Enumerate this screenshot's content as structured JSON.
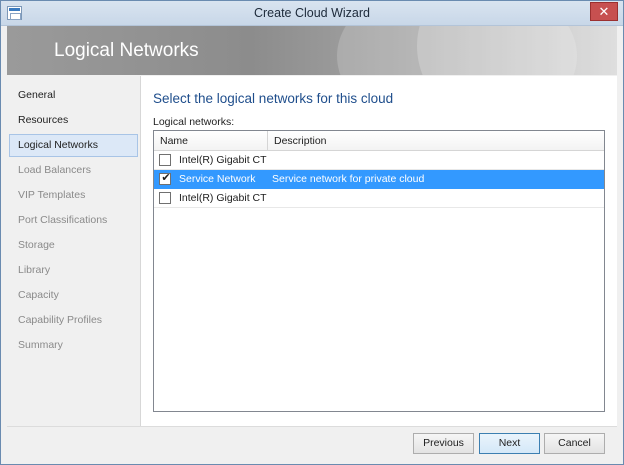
{
  "window": {
    "title": "Create Cloud Wizard",
    "close_glyph": "✕",
    "icon": "wizard-app-icon"
  },
  "banner": {
    "title": "Logical Networks"
  },
  "nav": {
    "items": [
      {
        "label": "General",
        "state": "normal"
      },
      {
        "label": "Resources",
        "state": "normal"
      },
      {
        "label": "Logical Networks",
        "state": "active"
      },
      {
        "label": "Load Balancers",
        "state": "muted"
      },
      {
        "label": "VIP Templates",
        "state": "muted"
      },
      {
        "label": "Port Classifications",
        "state": "muted"
      },
      {
        "label": "Storage",
        "state": "muted"
      },
      {
        "label": "Library",
        "state": "muted"
      },
      {
        "label": "Capacity",
        "state": "muted"
      },
      {
        "label": "Capability Profiles",
        "state": "muted"
      },
      {
        "label": "Summary",
        "state": "muted"
      }
    ]
  },
  "main": {
    "heading": "Select the logical networks for this cloud",
    "list_label": "Logical networks:",
    "columns": {
      "name": "Name",
      "description": "Description"
    },
    "rows": [
      {
        "name": "Intel(R) Gigabit CT De",
        "description": "",
        "checked": false,
        "selected": false
      },
      {
        "name": "Service Network",
        "description": "Service network for private cloud",
        "checked": true,
        "selected": true
      },
      {
        "name": "Intel(R) Gigabit CT De",
        "description": "",
        "checked": false,
        "selected": false
      }
    ],
    "check_glyph": "✔"
  },
  "footer": {
    "previous_label": "Previous",
    "next_label": "Next",
    "cancel_label": "Cancel"
  },
  "colors": {
    "selection": "#3399ff",
    "heading": "#1f4e8c",
    "close_button": "#c75050"
  }
}
